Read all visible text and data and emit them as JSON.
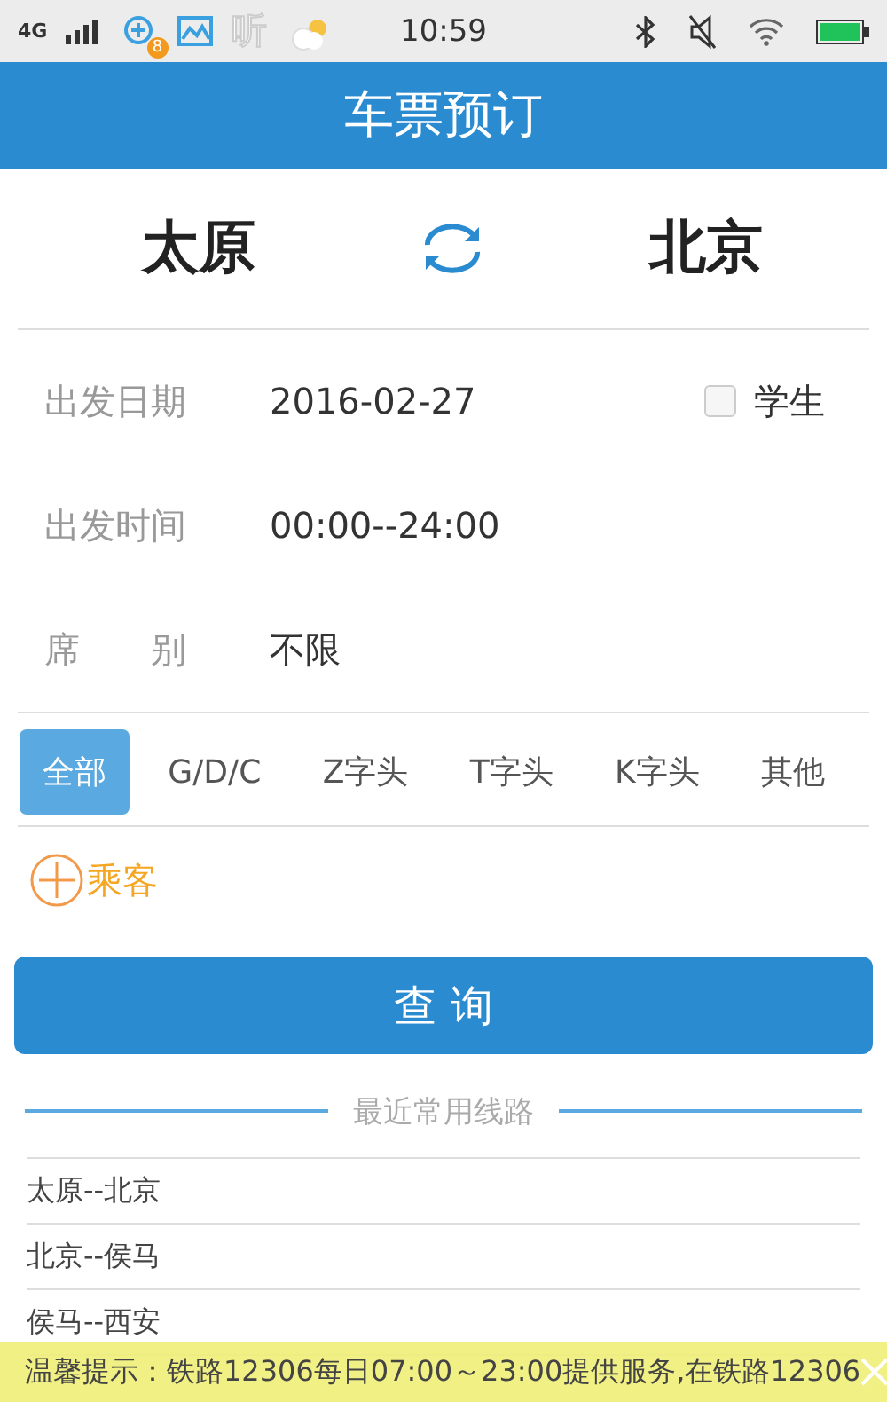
{
  "status_bar": {
    "network": "4G",
    "badge": "8",
    "app_glyph": "听",
    "time": "10:59"
  },
  "header": {
    "title": "车票预订"
  },
  "route": {
    "from": "太原",
    "to": "北京"
  },
  "fields": [
    {
      "kind": "date",
      "label": "出发日期",
      "value": "2016-02-27"
    },
    {
      "kind": "text",
      "label": "出发时间",
      "value": "00:00--24:00"
    },
    {
      "kind": "text",
      "label": "席　　别",
      "value": "不限"
    }
  ],
  "student": {
    "label": "学生",
    "checked": false
  },
  "train_types": [
    {
      "label": "全部",
      "selected": true
    },
    {
      "label": "G/D/C",
      "selected": false
    },
    {
      "label": "Z字头",
      "selected": false
    },
    {
      "label": "T字头",
      "selected": false
    },
    {
      "label": "K字头",
      "selected": false
    },
    {
      "label": "其他",
      "selected": false
    }
  ],
  "passenger_button": "乘客",
  "query_button": "查 询",
  "recent": {
    "title": "最近常用线路",
    "routes": [
      "太原--北京",
      "北京--侯马",
      "侯马--西安"
    ]
  },
  "notice": {
    "text": "温馨提示：铁路12306每日07:00～23:00提供服务,在铁路12306"
  }
}
